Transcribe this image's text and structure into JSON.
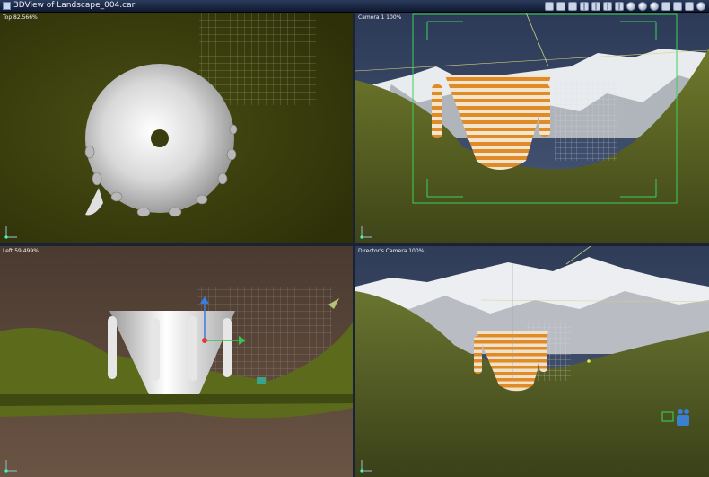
{
  "window": {
    "title": "3DView of Landscape_004.car"
  },
  "toolbar": {
    "icons": [
      "render-icon",
      "navigator-icon",
      "preview-icon",
      "layout-1-icon",
      "layout-2-icon",
      "layout-3-icon",
      "layout-4-icon",
      "camera-icon",
      "light-icon",
      "object-icon",
      "cube-top-icon",
      "cube-front-icon",
      "cube-side-icon",
      "sphere-icon"
    ]
  },
  "viewports": {
    "top": {
      "label": "Top 82.566%"
    },
    "camera1": {
      "label": "Camera 1 100%"
    },
    "left": {
      "label": "Left 59.499%"
    },
    "director": {
      "label": "Director's Camera 100%"
    }
  },
  "colors": {
    "titlebar": "#1c2a48",
    "top_bg": "#3a3d10",
    "left_sky": "#5a4538",
    "ground_green": "#5f6a22",
    "sky_blue": "#3b4a68",
    "object_stripe": "#d98a2b"
  }
}
